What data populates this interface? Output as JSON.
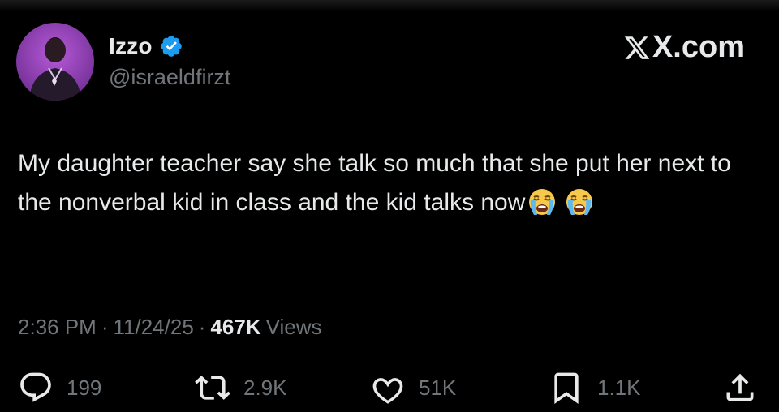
{
  "tweet": {
    "author": {
      "display_name": "Izzo",
      "handle": "@israeldfirzt",
      "verified": true,
      "avatar_icon": "profile-photo"
    },
    "site_label": "X.com",
    "text": "My daughter teacher say she talk so much that she put her next to the nonverbal kid in class and the kid talks now",
    "emojis": [
      "loudly-crying-face",
      "loudly-crying-face"
    ],
    "time": "2:36 PM",
    "date": "11/24/25",
    "separator": "·",
    "views_count": "467K",
    "views_label": "Views",
    "stats": {
      "replies": "199",
      "reposts": "2.9K",
      "likes": "51K",
      "bookmarks": "1.1K"
    }
  },
  "colors": {
    "background": "#000000",
    "text_primary": "#e7e9ea",
    "text_secondary": "#71767b",
    "verified_badge": "#1d9bf0"
  }
}
